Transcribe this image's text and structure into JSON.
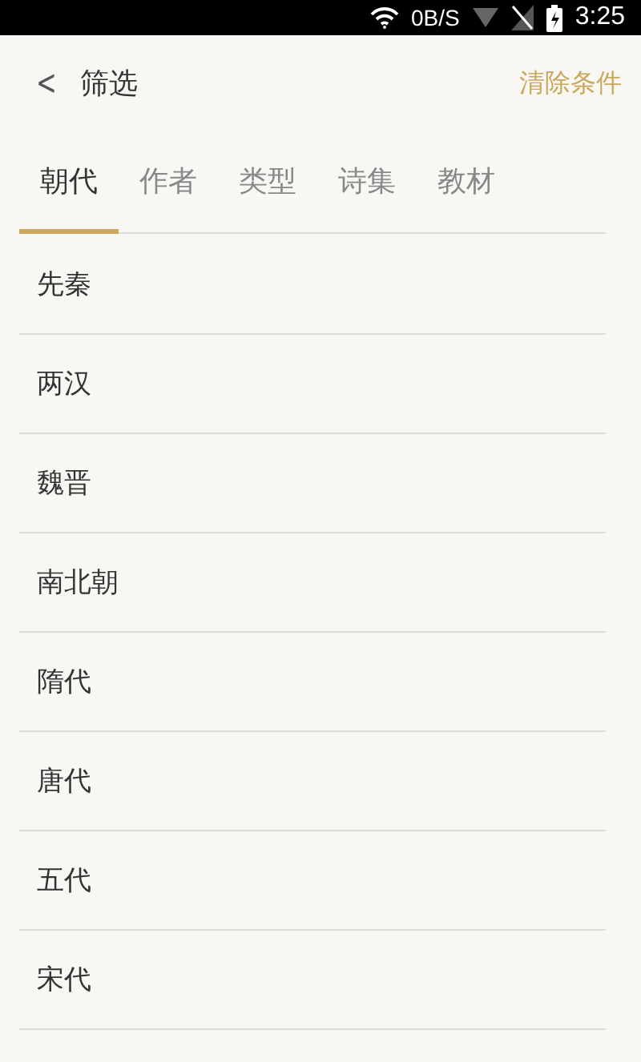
{
  "status_bar": {
    "speed": "0B/S",
    "time": "3:25"
  },
  "header": {
    "back": "<",
    "title": "筛选",
    "action": "清除条件"
  },
  "tabs": [
    {
      "label": "朝代",
      "selected": true
    },
    {
      "label": "作者",
      "selected": false
    },
    {
      "label": "类型",
      "selected": false
    },
    {
      "label": "诗集",
      "selected": false
    },
    {
      "label": "教材",
      "selected": false
    }
  ],
  "list": [
    {
      "label": "先秦"
    },
    {
      "label": "两汉"
    },
    {
      "label": "魏晋"
    },
    {
      "label": "南北朝"
    },
    {
      "label": "隋代"
    },
    {
      "label": "唐代"
    },
    {
      "label": "五代"
    },
    {
      "label": "宋代"
    }
  ]
}
